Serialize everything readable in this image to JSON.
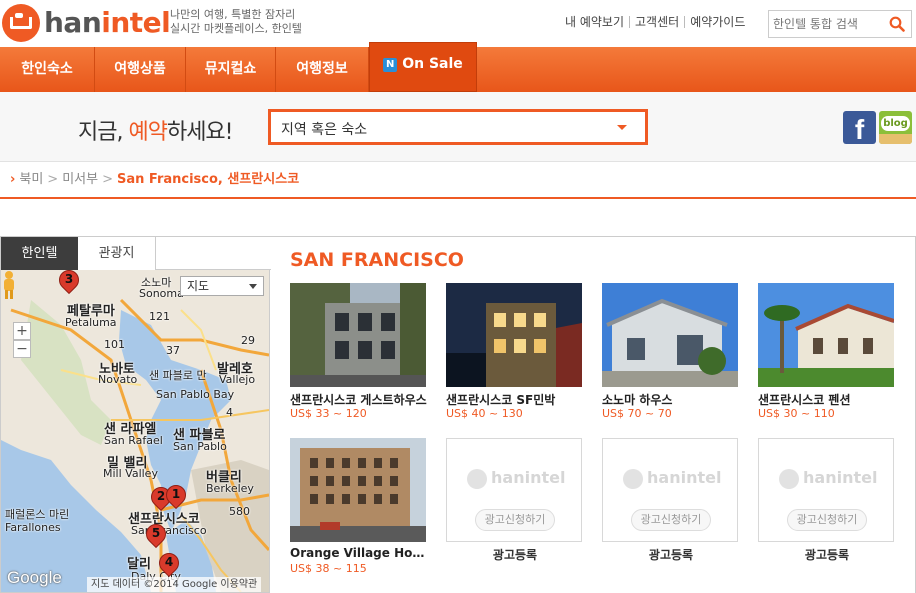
{
  "brand": {
    "logo_text_main": "han",
    "logo_text_accent": "intel",
    "tagline_line1": "나만의 여행, 특별한 잠자리",
    "tagline_line2": "실시간 마켓플레이스, 한인텔",
    "accent_color": "#ef5a24"
  },
  "util_links": [
    "내 예약보기",
    "고객센터",
    "예약가이드"
  ],
  "top_search": {
    "placeholder": "한인텔 통합 검색",
    "icon": "search-icon"
  },
  "nav": {
    "items": [
      "한인숙소",
      "여행상품",
      "뮤지컬쇼",
      "여행정보"
    ],
    "sale_badge": "N",
    "sale_label": "On Sale"
  },
  "search_band": {
    "headline_prefix": "지금, ",
    "headline_accent": "예약",
    "headline_suffix": "하세요!",
    "region_select_value": "지역 혹은 숙소",
    "facebook_label": "f",
    "blog_label": "blog"
  },
  "breadcrumb": {
    "items": [
      "북미",
      "미서부"
    ],
    "current": "San Francisco, 샌프란시스코"
  },
  "map": {
    "tabs": [
      "한인텔",
      "관광지"
    ],
    "map_type": "지도",
    "zoom_in": "+",
    "zoom_out": "−",
    "labels": {
      "sonoma_ko": "소노마",
      "sonoma_en": "Sonoma",
      "petaluma_ko": "페탈루마",
      "petaluma_en": "Petaluma",
      "novato_ko": "노바토",
      "novato_en": "Novato",
      "vallejo_ko": "발레호",
      "vallejo_en": "Vallejo",
      "sanpablobay_ko": "샌 파블로 만",
      "sanpablobay_en": "San Pablo Bay",
      "sanrafael_ko": "샌 라파엘",
      "sanrafael_en": "San Rafael",
      "sanpablo_ko": "샌 파블로",
      "sanpablo_en": "San Pablo",
      "millvalley_ko": "밀 밸리",
      "millvalley_en": "Mill Valley",
      "berkeley_ko": "버클리",
      "berkeley_en": "Berkeley",
      "sf_ko": "샌프란시스코",
      "sf_en": "San Francisco",
      "daly_ko": "달리",
      "daly_en": "Daly City",
      "farallones_ko": "패럴론스 마린",
      "farallones_en": "Farallones",
      "road_121": "121",
      "road_101": "101",
      "road_37": "37",
      "road_29": "29",
      "road_4": "4",
      "road_580": "580"
    },
    "markers": [
      "3",
      "2",
      "1",
      "5",
      "4"
    ],
    "google_logo": "Google",
    "footer": "지도 데이터 ©2014 Google   이용약관"
  },
  "listings": {
    "city": "SAN FRANCISCO",
    "cards": [
      {
        "name": "샌프란시스코 게스트하우스",
        "price": "US$ 33 ~ 120"
      },
      {
        "name": "샌프란시스코 SF민박",
        "price": "US$ 40 ~ 130"
      },
      {
        "name": "소노마 하우스",
        "price": "US$ 70 ~ 70"
      },
      {
        "name": "샌프란시스코 펜션",
        "price": "US$ 30 ~ 110"
      },
      {
        "name": "Orange Village Hostel",
        "price": "US$ 38 ~ 115"
      }
    ],
    "ads": [
      {
        "logo": "hanintel",
        "button": "광고신청하기",
        "label": "광고등록"
      },
      {
        "logo": "hanintel",
        "button": "광고신청하기",
        "label": "광고등록"
      },
      {
        "logo": "hanintel",
        "button": "광고신청하기",
        "label": "광고등록"
      }
    ]
  }
}
